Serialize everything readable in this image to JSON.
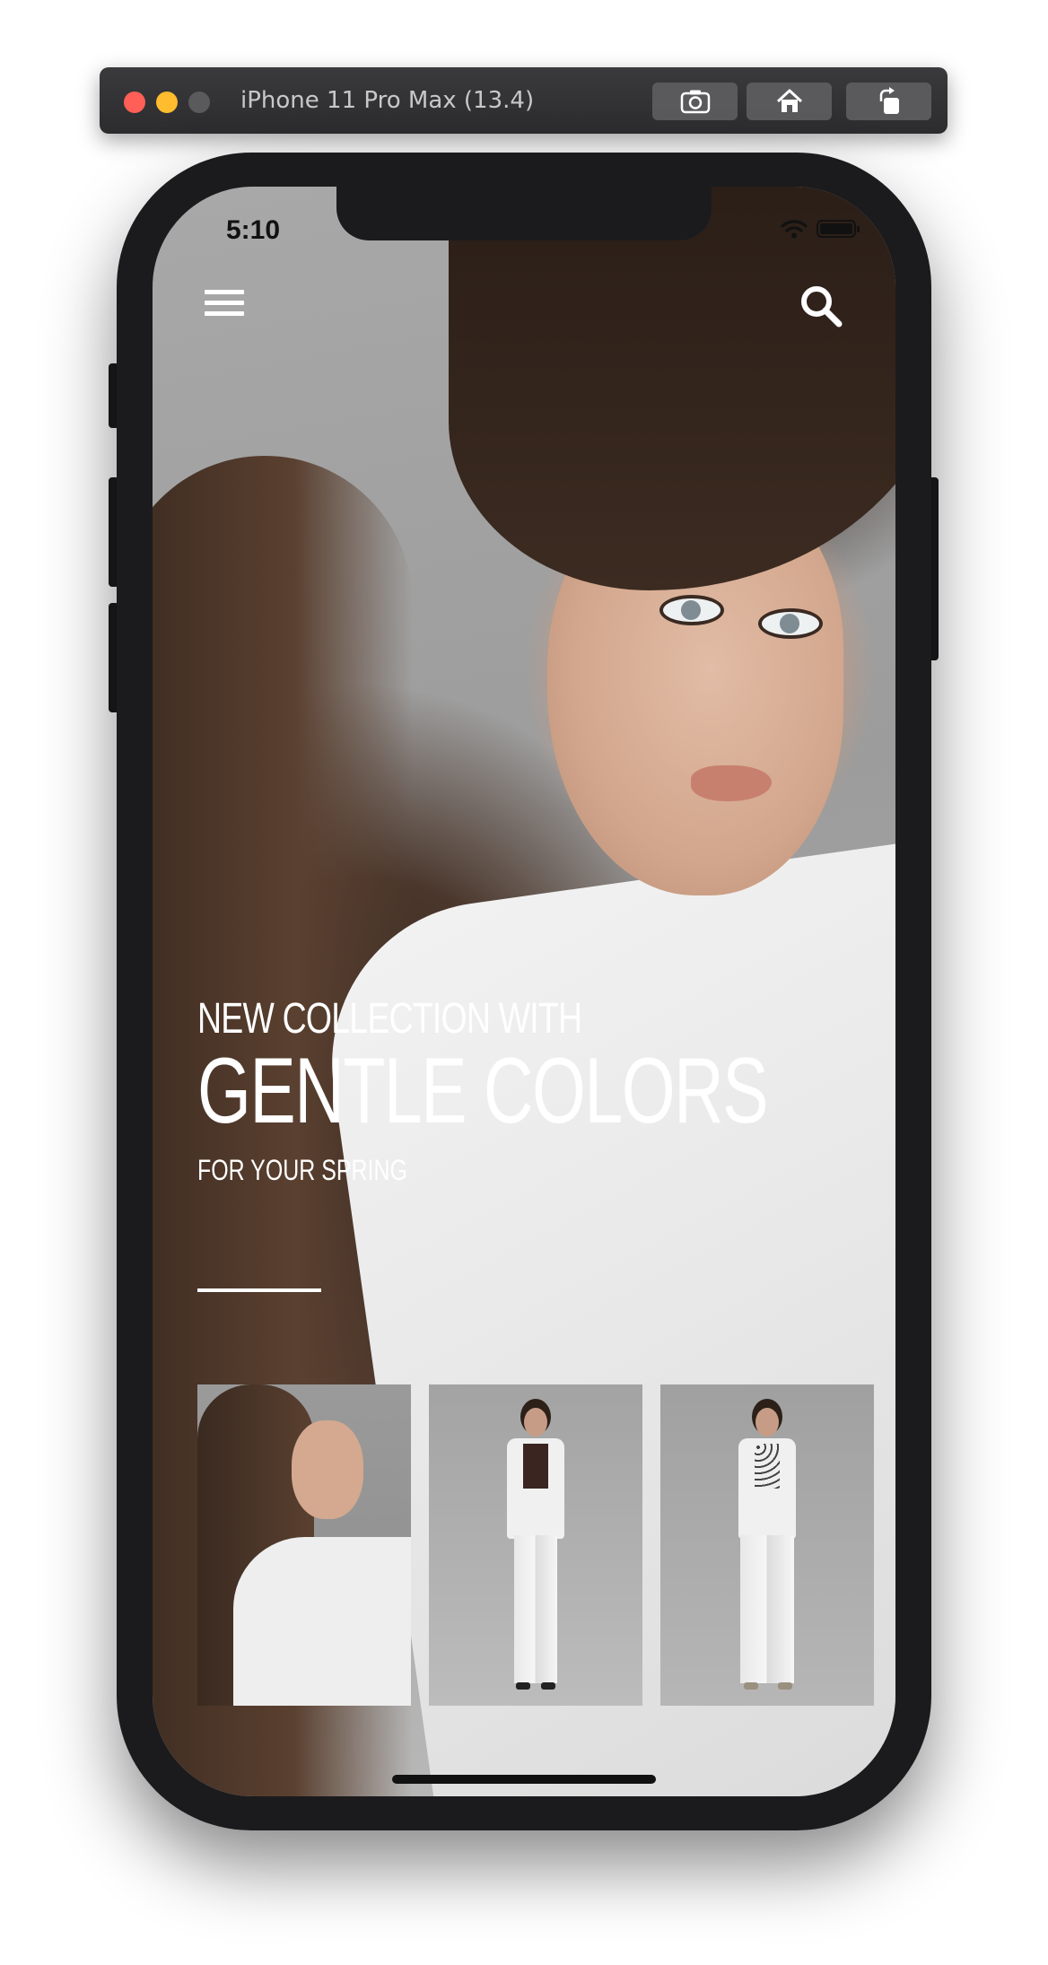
{
  "simulator": {
    "title": "iPhone 11 Pro Max (13.4)",
    "buttons": [
      {
        "icon": "screenshot-icon"
      },
      {
        "icon": "home-icon"
      },
      {
        "icon": "rotate-icon"
      }
    ]
  },
  "status_bar": {
    "time": "5:10",
    "icons": [
      "wifi-icon",
      "battery-icon"
    ]
  },
  "header": {
    "menu_icon": "hamburger-menu-icon",
    "search_icon": "search-icon"
  },
  "hero": {
    "line1": "NEW COLLECTION WITH",
    "line2": "GENTLE COLORS",
    "line3": "FOR YOUR SPRING"
  },
  "thumbnails": [
    {
      "subject": "portrait"
    },
    {
      "subject": "white-suit-dark-top"
    },
    {
      "subject": "white-suit-dotted-top"
    }
  ],
  "colors": {
    "text": "#ffffff",
    "window_bar": "#2c2c2e",
    "traffic_red": "#ff5f57",
    "traffic_yellow": "#febc2e",
    "bezel": "#1b1b1d"
  }
}
